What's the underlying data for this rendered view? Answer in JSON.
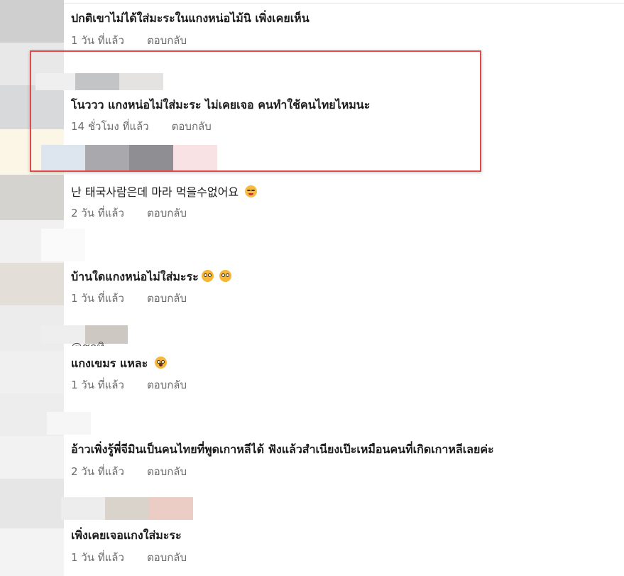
{
  "comments": [
    {
      "text": "ปกติเขาไม่ได้ใส่มะระในแกงหน่อไม้นิ เพิ่งเคยเห็น",
      "time": "1 วัน ที่แล้ว",
      "reply": "ตอบกลับ",
      "emoji": []
    },
    {
      "text": "โนววว แกงหน่อไม่ใส่มะระ ไม่เคยเจอ คนทำใช้คนไทยไหมนะ",
      "time": "14 ชั่วโมง ที่แล้ว",
      "reply": "ตอบกลับ",
      "emoji": []
    },
    {
      "text": "난 태국사람은데 마라 먹을수없어요",
      "time": "2 วัน ที่แล้ว",
      "reply": "ตอบกลับ",
      "emoji": [
        "laughing-face-emoji"
      ]
    },
    {
      "text": "บ้านใดแกงหน่อไม่ใส่มะระ",
      "time": "1 วัน ที่แล้ว",
      "reply": "ตอบกลับ",
      "emoji": [
        "flushed-face-emoji",
        "flushed-face-emoji"
      ]
    },
    {
      "text": "@ชลทิ",
      "time": "",
      "reply": "",
      "emoji": []
    },
    {
      "text": "แกงเขมร แหละ",
      "time": "1 วัน ที่แล้ว",
      "reply": "ตอบกลับ",
      "emoji": [
        "yawning-face-emoji"
      ]
    },
    {
      "text": "อ้าวเพิ่งรู้พี่จีมินเป็นคนไทยที่พูดเกาหลีได้ ฟังแล้วสำเนียงเป๊ะเหมือนคนที่เกิดเกาหลีเลยค่ะ",
      "time": "2 วัน ที่แล้ว",
      "reply": "ตอบกลับ",
      "emoji": []
    },
    {
      "text": "เพิ่งเคยเจอแกงใส่มะระ",
      "time": "1 วัน ที่แล้ว",
      "reply": "ตอบกลับ",
      "emoji": []
    }
  ],
  "colors": {
    "highlight": "#e04a4a",
    "meta_text": "#6b6b6b",
    "body_text": "#1c1c1c"
  }
}
